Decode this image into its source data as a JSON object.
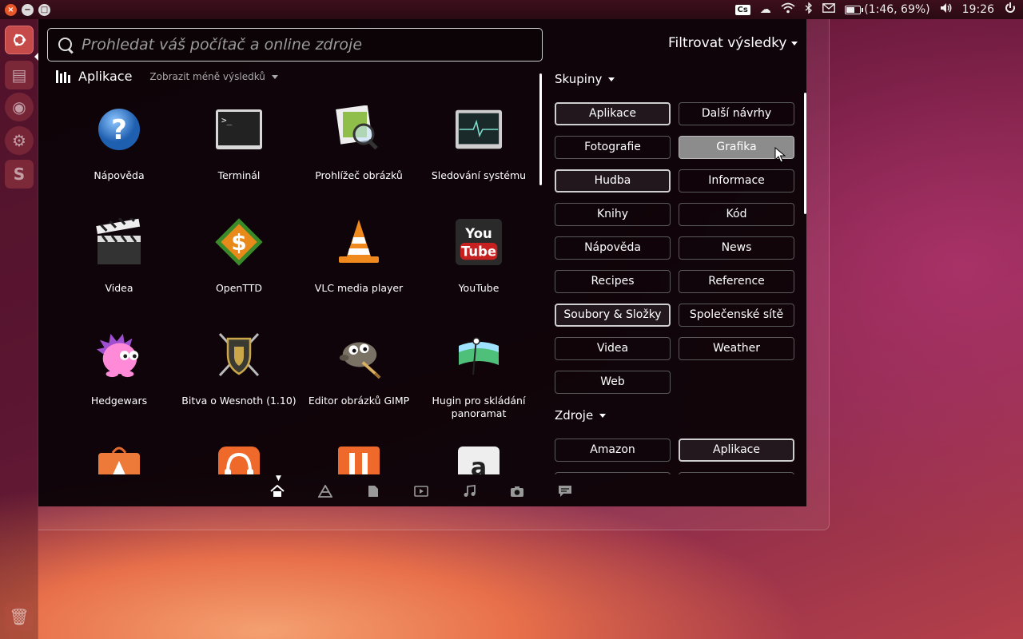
{
  "top_panel": {
    "keyboard_layout": "Cs",
    "battery_text": "(1:46, 69%)",
    "clock": "19:26",
    "icons": [
      "cloud-icon",
      "wifi-icon",
      "bluetooth-icon",
      "mail-icon",
      "battery-icon",
      "volume-icon",
      "power-icon"
    ]
  },
  "launcher": {
    "items": [
      "dash-icon",
      "files-icon",
      "firefox-icon",
      "settings-icon",
      "software-center-icon",
      "trash-icon"
    ]
  },
  "search": {
    "placeholder": "Prohledat váš počítač a online zdroje",
    "value": ""
  },
  "filter_toggle": {
    "label": "Filtrovat výsledky"
  },
  "category": {
    "title": "Aplikace",
    "more_label": "Zobrazit méně výsledků"
  },
  "apps": [
    {
      "label": "Nápověda",
      "icon": "help-icon"
    },
    {
      "label": "Terminál",
      "icon": "terminal-icon"
    },
    {
      "label": "Prohlížeč obrázků",
      "icon": "image-viewer-icon"
    },
    {
      "label": "Sledování systému",
      "icon": "system-monitor-icon"
    },
    {
      "label": "Videa",
      "icon": "clapperboard-icon"
    },
    {
      "label": "OpenTTD",
      "icon": "openttd-icon"
    },
    {
      "label": "VLC media player",
      "icon": "vlc-cone-icon"
    },
    {
      "label": "YouTube",
      "icon": "youtube-icon"
    },
    {
      "label": "Hedgewars",
      "icon": "hedgehog-icon"
    },
    {
      "label": "Bitva o Wesnoth (1.10)",
      "icon": "wesnoth-shield-icon"
    },
    {
      "label": "Editor obrázků GIMP",
      "icon": "gimp-icon"
    },
    {
      "label": "Hugin pro skládání panoramat",
      "icon": "hugin-icon"
    },
    {
      "label": "",
      "icon": "software-center-bag-icon"
    },
    {
      "label": "",
      "icon": "radio-icon"
    },
    {
      "label": "",
      "icon": "orange-app-icon"
    },
    {
      "label": "",
      "icon": "amazon-icon"
    }
  ],
  "filters": {
    "groups_title": "Skupiny",
    "groups": [
      {
        "label": "Aplikace",
        "state": "on"
      },
      {
        "label": "Další návrhy",
        "state": "off"
      },
      {
        "label": "Fotografie",
        "state": "off"
      },
      {
        "label": "Grafika",
        "state": "hover"
      },
      {
        "label": "Hudba",
        "state": "on"
      },
      {
        "label": "Informace",
        "state": "off"
      },
      {
        "label": "Knihy",
        "state": "off"
      },
      {
        "label": "Kód",
        "state": "off"
      },
      {
        "label": "Nápověda",
        "state": "off"
      },
      {
        "label": "News",
        "state": "off"
      },
      {
        "label": "Recipes",
        "state": "off"
      },
      {
        "label": "Reference",
        "state": "off"
      },
      {
        "label": "Soubory & Složky",
        "state": "on"
      },
      {
        "label": "Společenské sítě",
        "state": "off"
      },
      {
        "label": "Videa",
        "state": "off"
      },
      {
        "label": "Weather",
        "state": "off"
      },
      {
        "label": "Web",
        "state": "off"
      }
    ],
    "sources_title": "Zdroje",
    "sources": [
      {
        "label": "Amazon",
        "state": "off"
      },
      {
        "label": "Aplikace",
        "state": "on"
      }
    ]
  },
  "lens_bar": [
    "home-icon",
    "applications-lens-icon",
    "files-lens-icon",
    "video-lens-icon",
    "music-lens-icon",
    "photo-lens-icon",
    "social-lens-icon"
  ]
}
